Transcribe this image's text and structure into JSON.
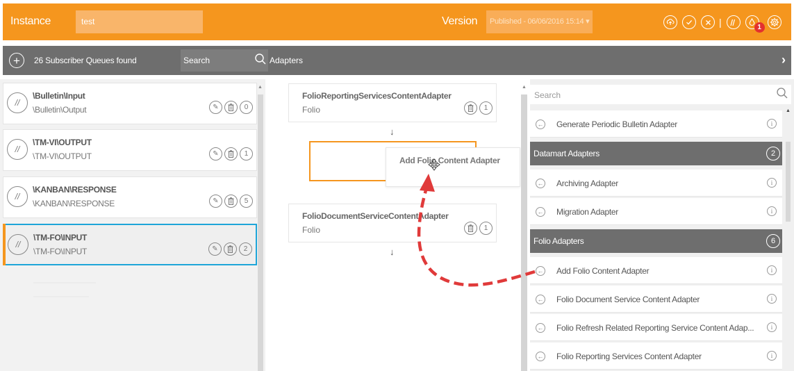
{
  "topbar": {
    "instance_label": "Instance",
    "instance_value": "test",
    "version_label": "Version",
    "version_value": "Published - 06/06/2016 15:14 ▾",
    "notification_count": "1"
  },
  "subbar": {
    "queue_count_text": "26 Subscriber Queues found",
    "search_label": "Search",
    "adapters_label": "Adapters"
  },
  "queues": [
    {
      "title": "\\Bulletin\\Input",
      "subtitle": "\\Bulletin\\Output",
      "count": "0"
    },
    {
      "title": "\\TM-VI\\OUTPUT",
      "subtitle": "\\TM-VI\\OUTPUT",
      "count": "1"
    },
    {
      "title": "\\KANBAN\\RESPONSE",
      "subtitle": "\\KANBAN\\RESPONSE",
      "count": "5"
    },
    {
      "title": "\\TM-FO\\INPUT",
      "subtitle": "\\TM-FO\\INPUT",
      "count": "2"
    }
  ],
  "pipeline": [
    {
      "title": "FolioReportingServicesContentAdapter",
      "subtitle": "Folio",
      "count": "1"
    },
    {
      "title": "FolioDocumentServiceContentAdapter",
      "subtitle": "Folio",
      "count": "1"
    }
  ],
  "drag_ghost_label": "Add Folio Content Adapter",
  "adapter_panel": {
    "search_placeholder": "Search",
    "top_item": "Generate Periodic Bulletin Adapter",
    "groups": [
      {
        "label": "Datamart Adapters",
        "count": "2",
        "items": [
          "Archiving Adapter",
          "Migration Adapter"
        ]
      },
      {
        "label": "Folio Adapters",
        "count": "6",
        "items": [
          "Add Folio Content Adapter",
          "Folio Document Service Content Adapter",
          "Folio Refresh Related Reporting Service Content Adap...",
          "Folio Reporting Services Content Adapter"
        ]
      }
    ]
  },
  "colors": {
    "accent": "#f5961e",
    "selection": "#1ea5d8",
    "bar": "#6e6e6e",
    "annotation": "#e03a3a"
  }
}
